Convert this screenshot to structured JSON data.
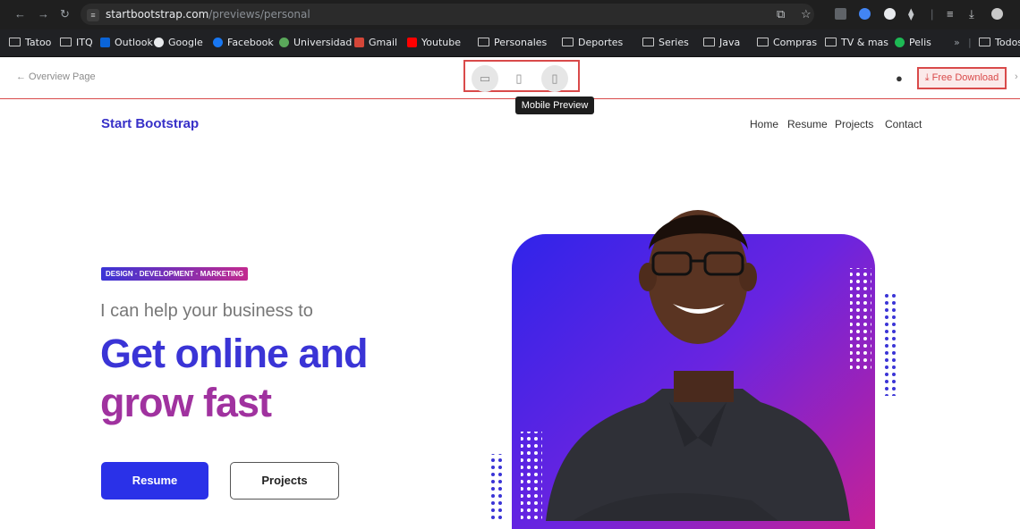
{
  "browser": {
    "url_host": "startbootstrap.com",
    "url_path": "/previews/personal",
    "bookmarks": [
      "Tatoo",
      "ITQ",
      "Outlook",
      "Google",
      "Facebook",
      "Universidad",
      "Gmail",
      "Youtube",
      "Personales",
      "Deportes",
      "Series",
      "Java",
      "Compras",
      "TV & mas",
      "Pelis"
    ],
    "more": "»",
    "all_bookmarks": "Todos los favori"
  },
  "toolbar": {
    "overview": "← Overview Page",
    "tooltip": "Mobile Preview",
    "free_download": "Free Download"
  },
  "site": {
    "brand": "Start Bootstrap",
    "nav": [
      "Home",
      "Resume",
      "Projects",
      "Contact"
    ],
    "badge": "DESIGN · DEVELOPMENT · MARKETING",
    "lead": "I can help your business to",
    "headline_1": "Get online and",
    "headline_2": "grow fast",
    "btn_resume": "Resume",
    "btn_projects": "Projects"
  },
  "colors": {
    "accent_red": "#d94a4a",
    "brand_blue": "#3a34d6",
    "brand_purple": "#a0329f"
  }
}
